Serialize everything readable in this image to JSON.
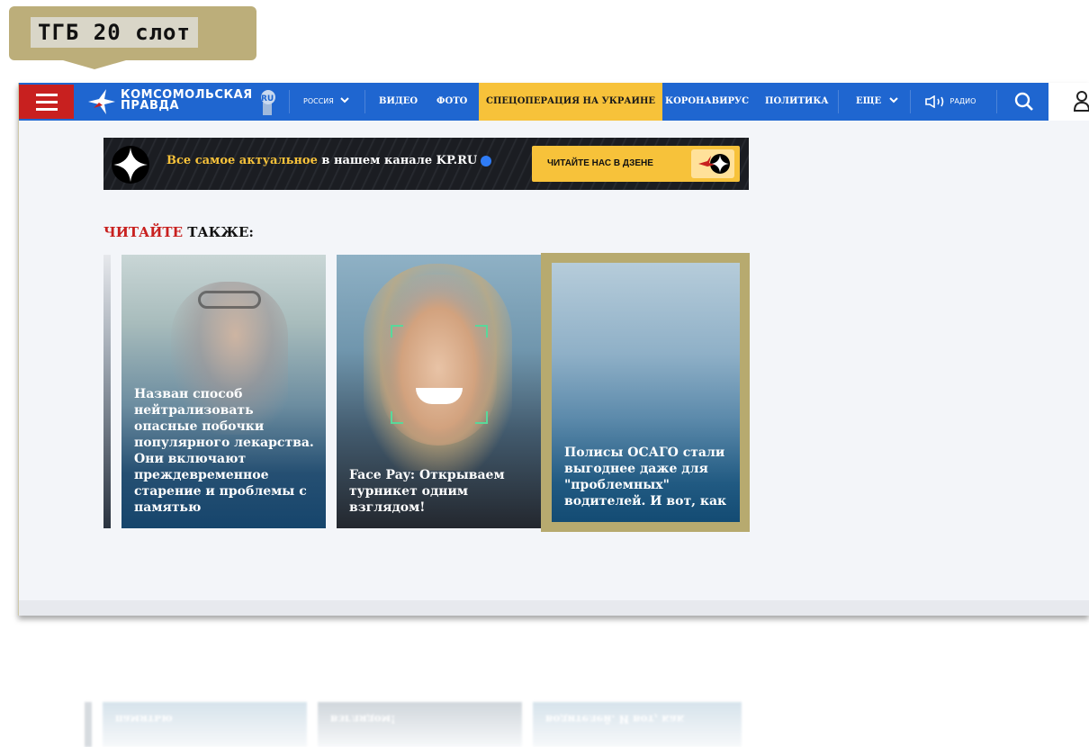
{
  "label": {
    "text": "ТГБ 20 слот"
  },
  "nav": {
    "logo": {
      "line1": "КОМСОМОЛЬСКАЯ",
      "line2": "ПРАВДА",
      "ru": "RU"
    },
    "region": "РОССИЯ",
    "items": [
      "ВИДЕО",
      "ФОТО",
      "СПЕЦОПЕРАЦИЯ НА УКРАИНЕ",
      "КОРОНАВИРУС",
      "ПОЛИТИКА"
    ],
    "more": "ЕЩЕ",
    "radio": "РАДИО"
  },
  "banner": {
    "highlight": "Все самое актуальное",
    "rest": " в нашем канале KP.RU",
    "button": "ЧИТАЙТЕ НАС В ДЗЕНЕ"
  },
  "read_also": {
    "red": "ЧИТАЙТЕ",
    "black": " ТАКЖЕ:"
  },
  "cards": [
    {
      "title": "Назван способ нейтрализовать опасные побочки популярного лекарства. Они включают преждевременное старение и проблемы с памятью"
    },
    {
      "title": "Face Pay: Открываем турникет одним взглядом!"
    },
    {
      "title": "Полисы ОСАГО стали выгоднее даже для \"проблемных\" водителей. И вот, как"
    }
  ],
  "reflection": {
    "t1": "памятью",
    "t2": "взглядом!",
    "t3": "водителей. И вот, как"
  },
  "colors": {
    "nav": "#1f66d0",
    "menu": "#c8201f",
    "highlight": "#f7c23a",
    "frame_accent": "#b7aa6f"
  }
}
